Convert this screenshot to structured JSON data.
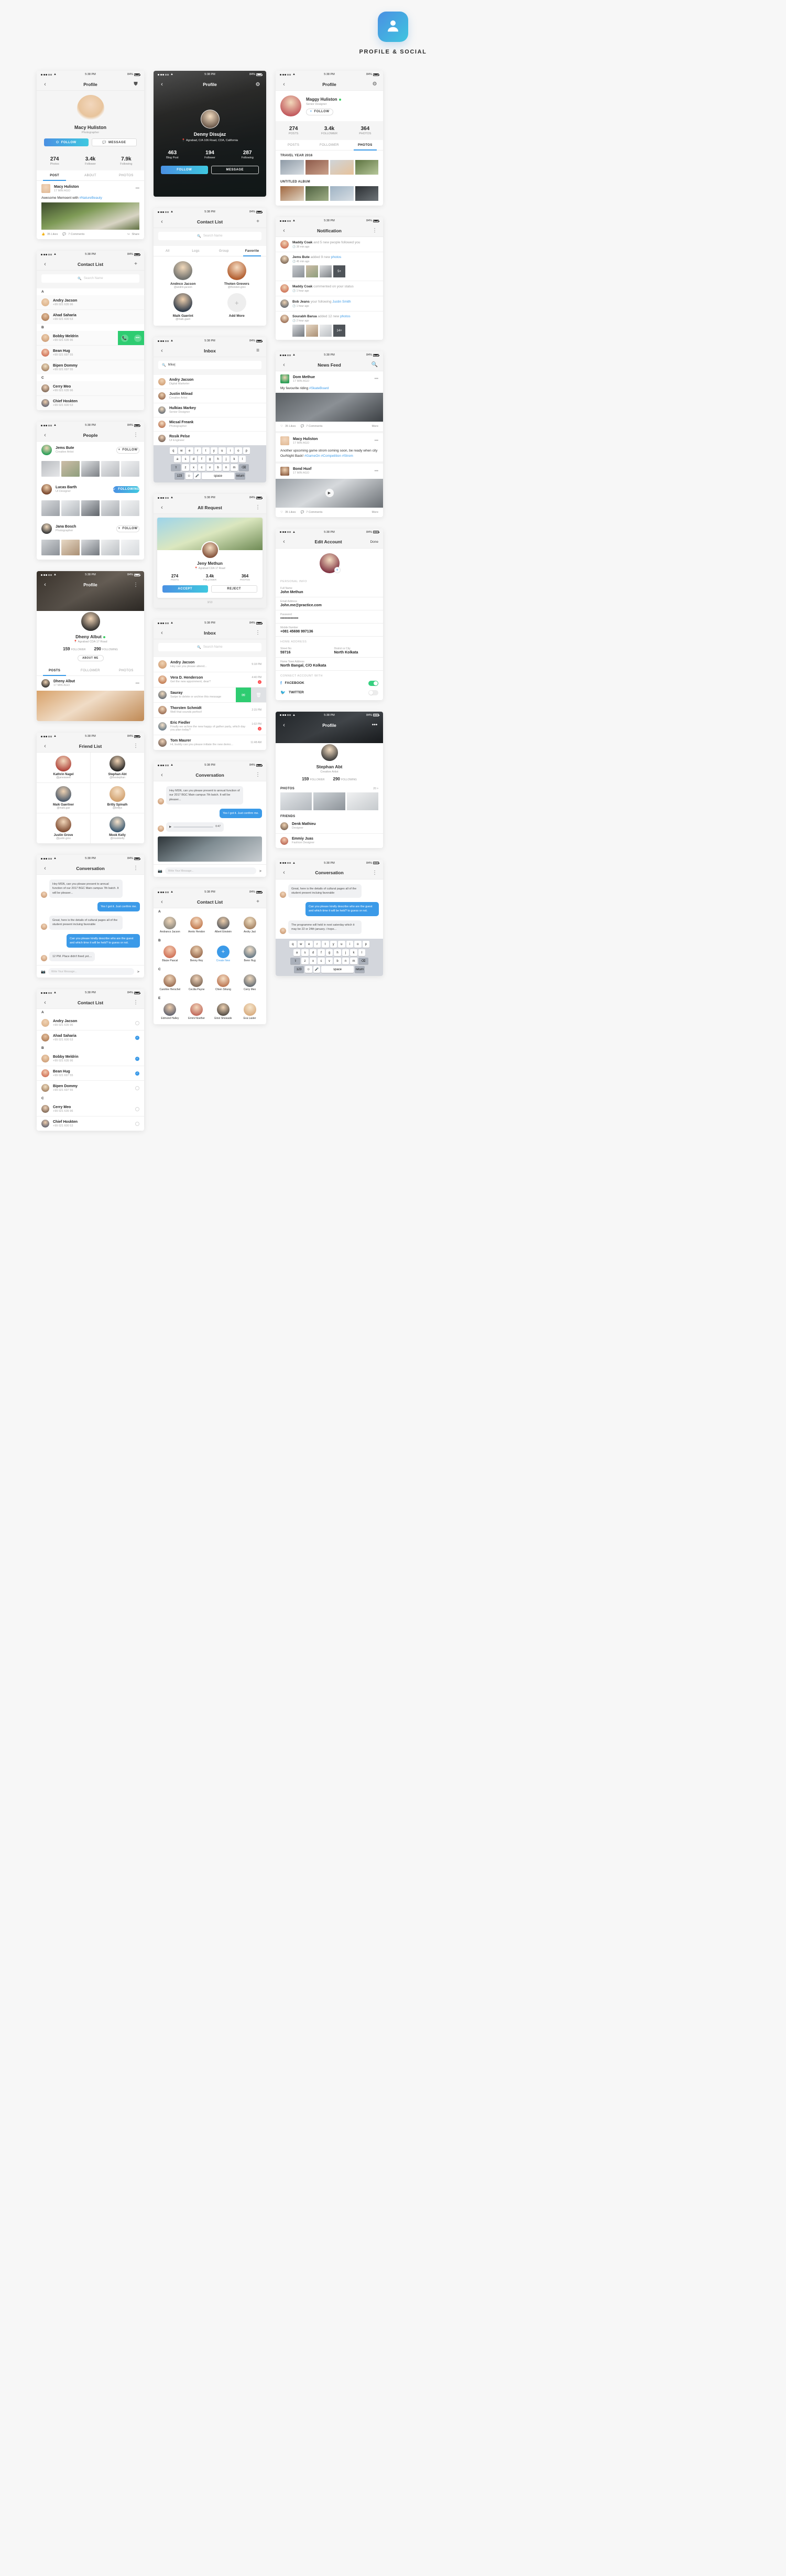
{
  "header": {
    "title": "PROFILE & SOCIAL",
    "logo_icon": "user-avatar-icon"
  },
  "status_bar": {
    "time": "5:38 PM",
    "battery": "84%",
    "wifi_icon": "wifi-icon",
    "signal_icon": "signal-dots-icon"
  },
  "screens": {
    "profile_macy": {
      "nav_title": "Profile",
      "back_icon": "chevron-left-icon",
      "action_icon": "bag-icon",
      "name": "Macy Huliston",
      "role": "Photographer",
      "follow_label": "FOLLOW",
      "message_label": "MESSAGE",
      "stats": [
        {
          "value": "274",
          "label": "Photos"
        },
        {
          "value": "3.4k",
          "label": "Follower"
        },
        {
          "value": "7.9k",
          "label": "Following"
        }
      ],
      "tabs": [
        "POST",
        "ABOUT",
        "PHOTOS"
      ],
      "active_tab": "POST",
      "post": {
        "author": "Macy Huliston",
        "time": "17 MIN AGO",
        "text": "Awesome Memoent with ",
        "hashtag": "#NatureBeauty",
        "likes": "35 Likes",
        "comments": "7 Comments",
        "share": "Share"
      }
    },
    "contact_list_a": {
      "nav_title": "Contact List",
      "add_icon": "plus-icon",
      "search_placeholder": "Search Name",
      "groups": [
        {
          "letter": "A",
          "people": [
            {
              "name": "Andry Jacson",
              "phone": "+99 021 635 96"
            },
            {
              "name": "Ahad Saharia",
              "phone": "+99 021 600 53"
            }
          ]
        },
        {
          "letter": "B",
          "people": [
            {
              "name": "Bobby Meldrin",
              "phone": "+99 021 635 96",
              "swiped": true
            },
            {
              "name": "Bean Hug",
              "phone": "+99 021 697 55"
            },
            {
              "name": "Bipen Dommy",
              "phone": "+99 021 697 55"
            }
          ]
        },
        {
          "letter": "C",
          "people": [
            {
              "name": "Cerry Meo",
              "phone": "+99 021 635 96"
            },
            {
              "name": "Chief Hoskten",
              "phone": "+99 021 600 53"
            }
          ]
        }
      ],
      "swipe_actions": [
        "call-icon",
        "more-icon"
      ]
    },
    "people": {
      "nav_title": "People",
      "menu_icon": "kebab-menu-icon",
      "list": [
        {
          "name": "Jems Bute",
          "role": "Creative Artist",
          "btn": "FOLLOW",
          "following": false
        },
        {
          "name": "Lucas Barth",
          "role": "UI Designer",
          "btn": "FOLLOWING",
          "following": true
        },
        {
          "name": "Jana Bosch",
          "role": "Photographer",
          "btn": "FOLLOW",
          "following": false
        }
      ]
    },
    "profile_dheny": {
      "nav_title": "Profile",
      "more_icon": "kebab-menu-icon",
      "name": "Dheny Albut",
      "location": "Agrabad CDA 17 Road",
      "stats": [
        {
          "value": "159",
          "label": "FOLLOWER"
        },
        {
          "value": "290",
          "label": "FOLLOWING"
        }
      ],
      "about_label": "ABOUT ME",
      "tabs": [
        "POSTS",
        "FOLLOWER",
        "PHOTOS"
      ],
      "active_tab": "POSTS",
      "post": {
        "author": "Dheny Albut",
        "time": "17 MIN AGO"
      }
    },
    "friend_list": {
      "nav_title": "Friend List",
      "menu_icon": "kebab-menu-icon",
      "friends": [
        {
          "name": "Kathrin Nagel",
          "handle": "@janesweet"
        },
        {
          "name": "Stephan Abt",
          "handle": "@thestephan"
        },
        {
          "name": "Maik Gaertner",
          "handle": "@maik.gae"
        },
        {
          "name": "Britly Spinalh",
          "handle": "@britlys"
        },
        {
          "name": "Justin Grove",
          "handle": "@justin.grov"
        },
        {
          "name": "Mook Kelly",
          "handle": "@mookkelly"
        }
      ]
    },
    "conversation_a": {
      "nav_title": "Conversation",
      "menu_icon": "kebab-menu-icon",
      "messages": [
        {
          "from": "them",
          "text": "Hey MSN, can you please present to annual function of our 2017 BGC Main campus 7th batch. It will be pleaser..."
        },
        {
          "from": "me",
          "text": "Yes I got it. Just confirm me."
        },
        {
          "from": "them",
          "text": "Great, here is the details of cultural pages all of the student present incluing favorable"
        },
        {
          "from": "me",
          "text": "Can you please kindly describe who are the guest and which time it will be held? to guess or not."
        },
        {
          "from": "them",
          "text": "12 PM. Place didn't fixed yet...."
        }
      ],
      "input_placeholder": "Write Your Message..."
    },
    "contact_list_b": {
      "nav_title": "Contact List",
      "menu_icon": "kebab-menu-icon",
      "groups": [
        {
          "letter": "A",
          "people": [
            {
              "name": "Andry Jacson",
              "phone": "+99 021 635 96",
              "checked": false
            },
            {
              "name": "Ahad Saharia",
              "phone": "+99 021 600 53",
              "checked": true
            }
          ]
        },
        {
          "letter": "B",
          "people": [
            {
              "name": "Bobby Meldrin",
              "phone": "+99 021 635 96",
              "checked": true
            },
            {
              "name": "Bean Hug",
              "phone": "+99 021 697 55",
              "checked": true
            },
            {
              "name": "Bipen Dommy",
              "phone": "+99 021 697 55",
              "checked": false
            }
          ]
        },
        {
          "letter": "C",
          "people": [
            {
              "name": "Cerry Meo",
              "phone": "+99 021 635 96",
              "checked": false
            },
            {
              "name": "Chief Hoskten",
              "phone": "+99 021 600 53",
              "checked": false
            }
          ]
        }
      ]
    },
    "profile_denny": {
      "nav_title": "Profile",
      "settings_icon": "gear-icon",
      "name": "Denny Disujaz",
      "location": "Agrabad, C/A 106 Road, CDA, California",
      "location_icon": "map-pin-icon",
      "stats": [
        {
          "value": "463",
          "label": "Blog Post"
        },
        {
          "value": "194",
          "label": "Follower"
        },
        {
          "value": "287",
          "label": "Following"
        }
      ],
      "follow_label": "FOLLOW",
      "message_label": "MESSAGE"
    },
    "contact_fav": {
      "nav_title": "Contact List",
      "add_icon": "plus-icon",
      "search_placeholder": "Search Name",
      "tabs": [
        "All",
        "Logs",
        "Group",
        "Favorite"
      ],
      "active_tab": "Favorite",
      "cards": [
        {
          "name": "Andnco Jacson",
          "handle": "@andrin.jacson"
        },
        {
          "name": "Thoten Grevers",
          "handle": "@thorsten.grev"
        },
        {
          "name": "Maik Gaerint",
          "handle": "@maik.gaeri"
        },
        {
          "name": "Add More",
          "handle": ""
        }
      ],
      "add_more_icon": "plus-icon"
    },
    "inbox_a": {
      "nav_title": "Inbox",
      "filter_icon": "filter-icon",
      "search_value": "Mike|",
      "results": [
        {
          "name": "Andry Jacson",
          "sub": "Digital Marketer"
        },
        {
          "name": "Justin Milead",
          "sub": "Creative Artist"
        },
        {
          "name": "Hulkias Markey",
          "sub": "Senior Designer"
        },
        {
          "name": "Micsal Freank",
          "sub": "Photographer"
        },
        {
          "name": "Rosik Pelse",
          "sub": "UI Engineer"
        }
      ],
      "keyboard": {
        "row1": [
          "q",
          "w",
          "e",
          "r",
          "t",
          "y",
          "u",
          "i",
          "o",
          "p"
        ],
        "row2": [
          "a",
          "s",
          "d",
          "f",
          "g",
          "h",
          "j",
          "k",
          "l"
        ],
        "row3": [
          "z",
          "x",
          "c",
          "v",
          "b",
          "n",
          "m"
        ],
        "shift": "shift-icon",
        "backspace": "backspace-icon",
        "numeric": "123",
        "emoji": "emoji-icon",
        "mic": "mic-icon",
        "space": "space",
        "return": "return"
      }
    },
    "all_request": {
      "nav_title": "All Request",
      "menu_icon": "kebab-menu-icon",
      "name": "Jeny Methun",
      "location": "Agrabad CDA 17 Road",
      "stats": [
        {
          "value": "274",
          "label": "POSTS"
        },
        {
          "value": "3.4k",
          "label": "FOLLOWER"
        },
        {
          "value": "364",
          "label": "PHOTOS"
        }
      ],
      "accept_label": "ACCEPT",
      "reject_label": "REJECT",
      "pager": "3/13"
    },
    "inbox_b": {
      "nav_title": "Inbox",
      "menu_icon": "kebab-menu-icon",
      "search_placeholder": "Search Name",
      "threads": [
        {
          "name": "Andry Jacson",
          "msg": "Hey can you please attend...",
          "time": "5:18 PM",
          "unread": ""
        },
        {
          "name": "Vera D. Henderson",
          "msg": "Get the new appoinment, dear?",
          "time": "4:40 PM",
          "unread": "2"
        },
        {
          "name": "Sauray",
          "msg": "Swipe to delete or archive this message",
          "time": "3:30 PM",
          "unread": "",
          "swiped": true
        },
        {
          "name": "Thorsten Schmidt",
          "msg": "Well that sounds perfect!",
          "time": "2:15 PM",
          "unread": ""
        },
        {
          "name": "Eric Fiedler",
          "msg": "Finally we achive the new happy of gather party, which day you plan today?",
          "time": "1:02 PM",
          "unread": "4"
        },
        {
          "name": "Tom Maurer",
          "msg": "Hi, buddy can you please initiate the new demo...",
          "time": "11:48 AM",
          "unread": ""
        }
      ],
      "swipe_actions": [
        "archive-icon",
        "delete-icon"
      ]
    },
    "conversation_b": {
      "nav_title": "Conversation",
      "menu_icon": "kebab-menu-icon",
      "messages": [
        {
          "from": "them",
          "text": "Hey MSN, can you please present to annual function of our 2017 BGC Main campus 7th batch. It will be pleaser..."
        },
        {
          "from": "me",
          "text": "Yes I got it. Just confirm me."
        }
      ],
      "voice_time": "0:47",
      "input_placeholder": "Write Your Message..."
    },
    "contact_grid": {
      "nav_title": "Contact List",
      "add_icon": "plus-icon",
      "groups": [
        {
          "letter": "A",
          "people": [
            "Andranco Jacson",
            "Annto Hendon",
            "Albert Einstein",
            "Andry Jaci"
          ]
        },
        {
          "letter": "B",
          "people": [
            "Blaize Pascal",
            "Benny Rey",
            "Create New",
            "Benn Hug"
          ]
        },
        {
          "letter": "C",
          "people": [
            "Caroline Herschel",
            "Cecilia Payne",
            "Chien Shiung",
            "Cerry Meo"
          ]
        },
        {
          "letter": "E",
          "people": [
            "Edmond Halley",
            "Emmi Noether",
            "Einst Showade",
            "Eva Laster"
          ]
        }
      ],
      "create_new_label": "Create New"
    },
    "profile_maggy": {
      "nav_title": "Profile",
      "settings_icon": "gear-icon",
      "name": "Maggy Huliston",
      "role": "Senior Designer",
      "follow_label": "FOLLOW",
      "online": true,
      "stats": [
        {
          "value": "274",
          "label": "POSTS"
        },
        {
          "value": "3.4k",
          "label": "FOLLOWER"
        },
        {
          "value": "364",
          "label": "PHOTOS"
        }
      ],
      "tabs": [
        "POSTS",
        "FOLLOWER",
        "PHOTOS"
      ],
      "active_tab": "PHOTOS",
      "albums": [
        {
          "title": "TRAVEL YEAR 2016"
        },
        {
          "title": "UNTITLED ALBUM"
        }
      ]
    },
    "notification": {
      "nav_title": "Notification",
      "menu_icon": "kebab-menu-icon",
      "items": [
        {
          "who": "Maddy Coak",
          "action": "and 5 new people followed you",
          "time": "38 min ago",
          "link": ""
        },
        {
          "who": "Jems Bute",
          "action": "added 9 new ",
          "link": "photos",
          "time": "45 min ago",
          "has_photos": true,
          "overflow": "5+"
        },
        {
          "who": "Maddy Coak",
          "action": "commented on your status",
          "time": "1 hour ago",
          "link": ""
        },
        {
          "who": "Bob Jeans",
          "action": "your following ",
          "link": "Justin Smith",
          "time": "1 hour ago"
        },
        {
          "who": "Sourabh Barua",
          "action": "added 12 new ",
          "link": "photos",
          "time": "2 hour ago",
          "has_photos": true,
          "overflow": "14+"
        }
      ],
      "clock_icon": "clock-icon"
    },
    "news_feed": {
      "nav_title": "News Feed",
      "search_icon": "search-icon",
      "posts": [
        {
          "author": "Dom Methue",
          "time": "17 MIN AGO",
          "text": "My favourite riding ",
          "hashtag": "#SkateBoard",
          "likes": "35 Likes",
          "comments": "7 Comments",
          "more": "More"
        },
        {
          "author": "Macy Huliston",
          "time": "17 MIN AGO",
          "text": "Another upcoming game strom coming soon, be ready when city OurNight Back! ",
          "hashtag": "#GameOn #Competition #Strom",
          "likes": "35 Likes",
          "comments": "7 Comments",
          "more": "More"
        },
        {
          "author": "Bond Huxf",
          "time": "17 MIN AGO",
          "text": "",
          "hashtag": "",
          "likes": "35 Likes",
          "comments": "7 Comments",
          "more": "More",
          "video": true
        }
      ],
      "play_icon": "play-icon"
    },
    "edit_account": {
      "nav_title": "Edit Account",
      "done_label": "Done",
      "add_photo_icon": "plus-icon",
      "personal_info_label": "PERSONAL INFO",
      "fields": [
        {
          "label": "Full Name",
          "value": "John Methun"
        },
        {
          "label": "Email Address",
          "value": "John.me@practice.com"
        },
        {
          "label": "Password",
          "value": "••••••••••••••"
        },
        {
          "label": "Mobile Number",
          "value": "+081  45698  997136"
        }
      ],
      "home_address_label": "HOME ADDRESS",
      "address_fields": [
        {
          "label": "Street No",
          "value": "59716"
        },
        {
          "label": "District or City",
          "value": "North Kolkata"
        }
      ],
      "hometown": {
        "label": "Home Town Address",
        "value": "North Bangal, C/O Kolkata"
      },
      "connect_label": "CONNECT ACCOUNT WITH",
      "socials": [
        {
          "name": "FACEBOOK",
          "icon": "facebook-icon",
          "on": true
        },
        {
          "name": "TWITTER",
          "icon": "twitter-icon",
          "on": false
        }
      ]
    },
    "profile_stephan": {
      "nav_title": "Profile",
      "more_icon": "kebab-menu-icon",
      "name": "Stephan Abt",
      "role": "Creative Artist",
      "stats": [
        {
          "value": "159",
          "label": "FOLLOWER"
        },
        {
          "value": "290",
          "label": "FOLLOWING"
        }
      ],
      "photos_label": "PHOTOS",
      "photos_count": "20 >",
      "friends_label": "FRIENDS",
      "friends": [
        {
          "name": "Denk Mathieu",
          "role": "Designer"
        },
        {
          "name": "Emmiy Juas",
          "role": "Fashion Designer"
        }
      ]
    },
    "conversation_c": {
      "nav_title": "Conversation",
      "menu_icon": "kebab-menu-icon",
      "messages": [
        {
          "from": "them",
          "text": "Great, here is the details of cultural pages all of the student present incluing favorable"
        },
        {
          "from": "me",
          "text": "Can you please kindly describe who are the guest and which time it will be held? to guess or not."
        },
        {
          "from": "them",
          "text": "The programme will held in next saterday which it may be 22 or 24th january. i hope..."
        }
      ],
      "keyboard": {
        "row1": [
          "q",
          "w",
          "e",
          "r",
          "t",
          "y",
          "u",
          "i",
          "o",
          "p"
        ],
        "row2": [
          "a",
          "s",
          "d",
          "f",
          "g",
          "h",
          "j",
          "k",
          "l"
        ],
        "row3": [
          "z",
          "x",
          "c",
          "v",
          "b",
          "n",
          "m"
        ],
        "numeric": "123",
        "space": "space",
        "return": "return"
      }
    }
  },
  "colors": {
    "accent": "#3b9ae8",
    "accent2": "#3fc8e0",
    "green": "#35d07f",
    "red": "#ff4d4f"
  }
}
